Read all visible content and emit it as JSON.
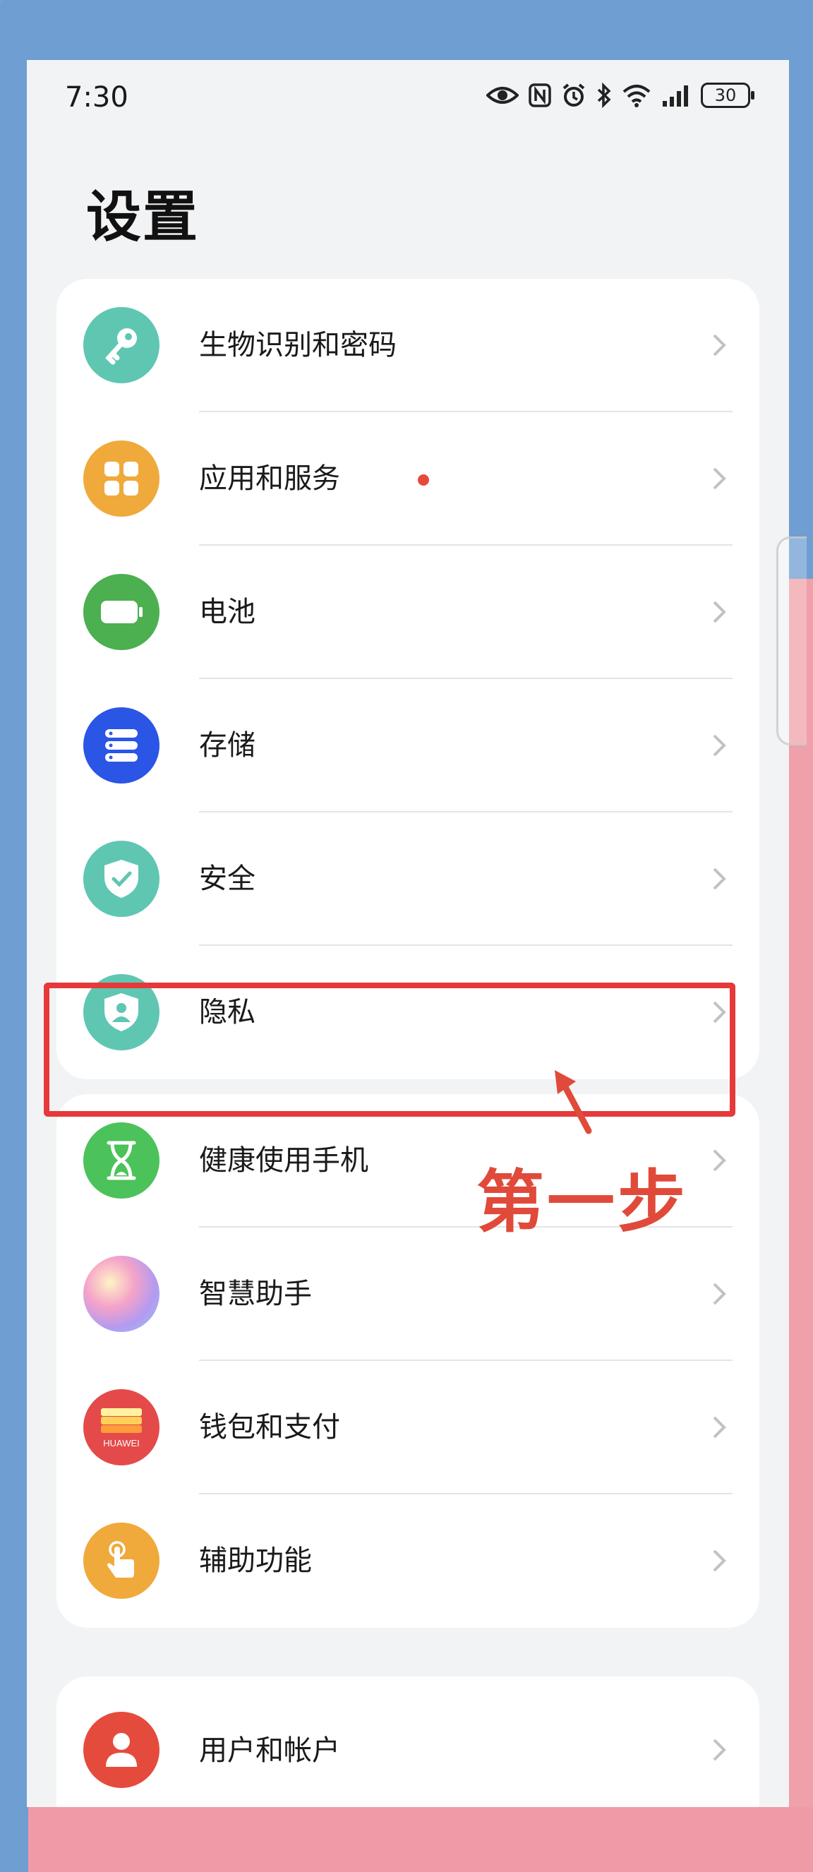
{
  "status_bar": {
    "time": "7:30",
    "battery": "30"
  },
  "page_title": "设置",
  "groups": [
    {
      "items": [
        {
          "label": "生物识别和密码",
          "icon": "key-icon",
          "color": "#5fc6b2"
        },
        {
          "label": "应用和服务",
          "icon": "apps-grid-icon",
          "color": "#f0a93b",
          "badge_dot": true
        },
        {
          "label": "电池",
          "icon": "battery-icon",
          "color": "#4caf50"
        },
        {
          "label": "存储",
          "icon": "storage-icon",
          "color": "#2a55e5"
        },
        {
          "label": "安全",
          "icon": "shield-check-icon",
          "color": "#5fc6b2"
        },
        {
          "label": "隐私",
          "icon": "privacy-shield-icon",
          "color": "#5fc6b2"
        }
      ]
    },
    {
      "items": [
        {
          "label": "健康使用手机",
          "icon": "hourglass-icon",
          "color": "#4cc25a"
        },
        {
          "label": "智慧助手",
          "icon": "assistant-orb-icon",
          "color": "#b9a2f0"
        },
        {
          "label": "钱包和支付",
          "icon": "wallet-icon",
          "color": "#e44a4a",
          "sublabel": "HUAWEI"
        },
        {
          "label": "辅助功能",
          "icon": "hand-tap-icon",
          "color": "#f0a93b"
        }
      ]
    },
    {
      "items": [
        {
          "label": "用户和帐户",
          "icon": "user-icon",
          "color": "#e54b3c"
        }
      ]
    }
  ],
  "annotation": {
    "step_text": "第一步",
    "highlight_color": "#e5393a"
  }
}
